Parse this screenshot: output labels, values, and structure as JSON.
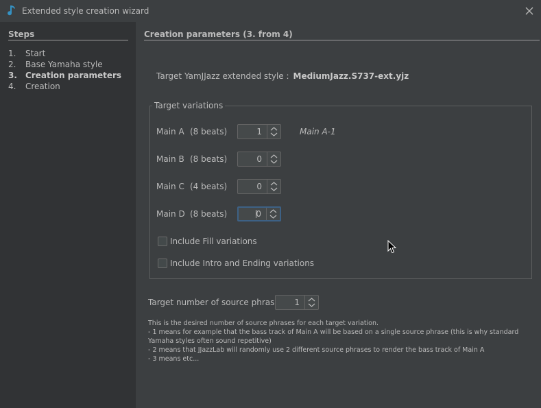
{
  "window": {
    "title": "Extended style creation wizard",
    "icon": "music-note-icon",
    "accent_color": "#3592c4"
  },
  "sidebar": {
    "header": "Steps",
    "steps": [
      {
        "num": "1.",
        "label": "Start"
      },
      {
        "num": "2.",
        "label": "Base Yamaha style"
      },
      {
        "num": "3.",
        "label": "Creation parameters",
        "current": true
      },
      {
        "num": "4.",
        "label": "Creation"
      }
    ]
  },
  "main": {
    "header": "Creation parameters (3. from 4)",
    "target_label": "Target YamJJazz extended style :",
    "target_value": "MediumJazz.S737-ext.yjz",
    "variations_group": {
      "legend": "Target variations",
      "rows": [
        {
          "label": "Main A",
          "beats": "(8 beats)",
          "value": "1",
          "name": "Main A-1"
        },
        {
          "label": "Main B",
          "beats": "(8 beats)",
          "value": "0",
          "name": ""
        },
        {
          "label": "Main C",
          "beats": "(4 beats)",
          "value": "0",
          "name": ""
        },
        {
          "label": "Main D",
          "beats": "(8 beats)",
          "value": "0",
          "name": "",
          "focused": true
        }
      ],
      "include_fill": {
        "label": "Include Fill variations",
        "checked": false
      },
      "include_intro_ending": {
        "label": "Include Intro and Ending variations",
        "checked": false
      }
    },
    "source_phrases": {
      "label": "Target number of source phrases",
      "value": "1"
    },
    "description": [
      "This is the desired number of source phrases for each target variation.",
      "- 1 means for example that the bass track of Main A will be based on a single source phrase (this is why standard",
      "Yamaha styles often sound repetitive)",
      "- 2 means that JJazzLab will randomly use 2 different source phrases to render the bass track of Main A",
      "- 3 means etc..."
    ]
  }
}
